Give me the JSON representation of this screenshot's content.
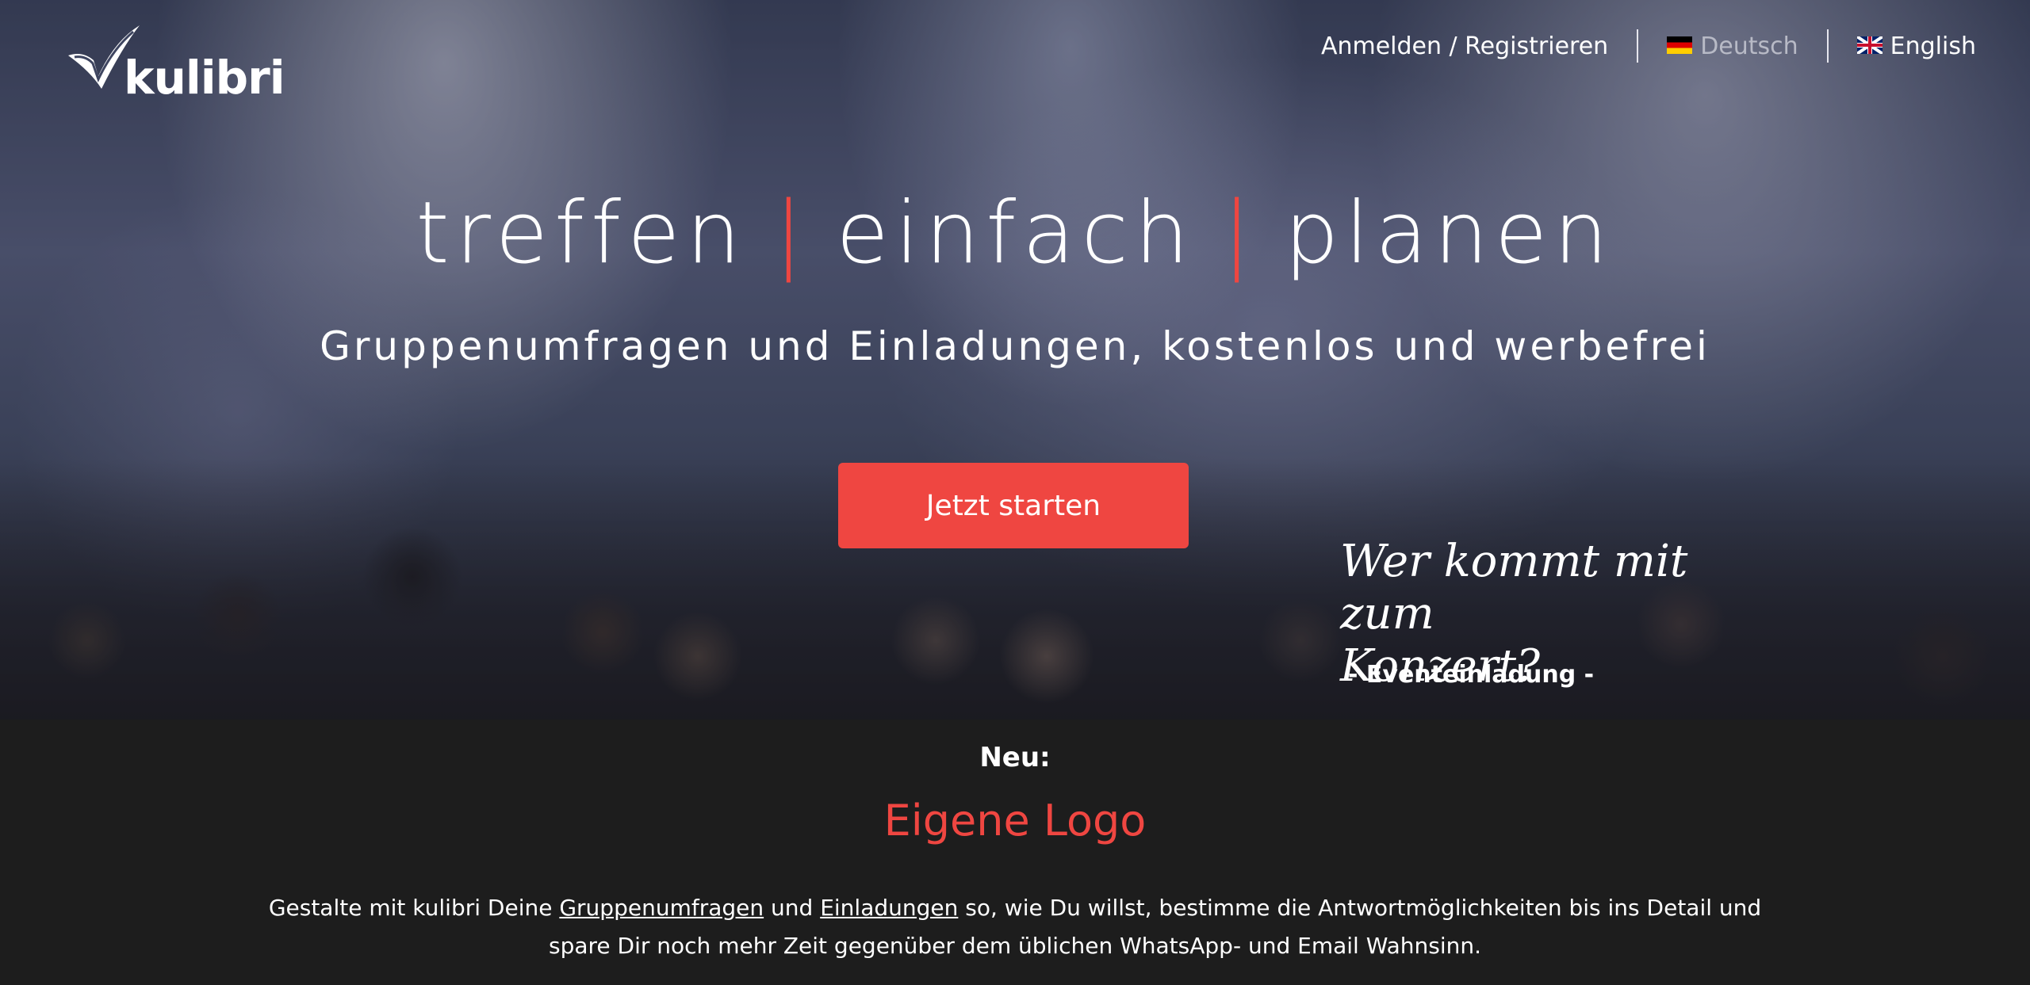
{
  "brand": {
    "name": "kulibri"
  },
  "nav": {
    "login": "Anmelden / Registrieren",
    "lang_de": "Deutsch",
    "lang_en": "English"
  },
  "hero": {
    "word1": "treffen",
    "separator": "|",
    "word2": "einfach",
    "word3": "planen",
    "subtitle": "Gruppenumfragen und Einladungen, kostenlos und werbefrei",
    "cta": "Jetzt starten",
    "quote_line1": "Wer kommt mit zum",
    "quote_line2": "Konzert?",
    "quote_tag": "- Eventeinladung -"
  },
  "news": {
    "label": "Neu:",
    "title": "Eigene Logo",
    "desc_part1": "Gestalte mit  kulibri Deine ",
    "link_polls": "Gruppenumfragen",
    "desc_part2": " und ",
    "link_invites": "Einladungen",
    "desc_part3": " so, wie Du willst,  bestimme die Antwortmöglichkeiten bis ins Detail und spare Dir noch mehr Zeit gegenüber dem üblichen WhatsApp- und Email Wahnsinn."
  },
  "colors": {
    "accent": "#ef4641",
    "background": "#1d1d1d"
  },
  "icons": {
    "logo": "checkmark-logo-icon",
    "flag_de": "flag-germany-icon",
    "flag_en": "flag-uk-icon"
  }
}
